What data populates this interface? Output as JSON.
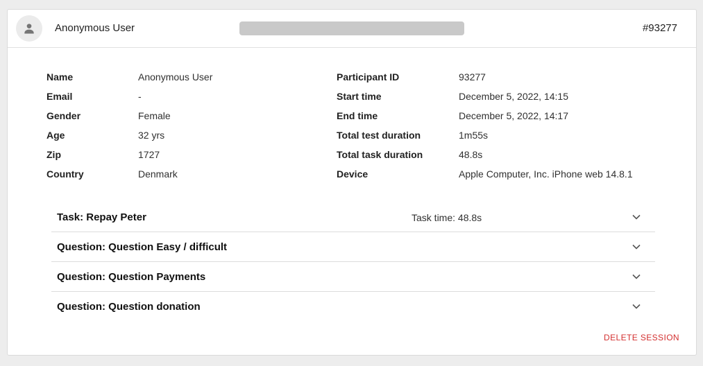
{
  "header": {
    "user_name": "Anonymous User",
    "participant_tag": "#93277"
  },
  "details_left": [
    {
      "label": "Name",
      "value": "Anonymous User"
    },
    {
      "label": "Email",
      "value": "-"
    },
    {
      "label": "Gender",
      "value": "Female"
    },
    {
      "label": "Age",
      "value": "32 yrs"
    },
    {
      "label": "Zip",
      "value": "1727"
    },
    {
      "label": "Country",
      "value": "Denmark"
    }
  ],
  "details_right": [
    {
      "label": "Participant ID",
      "value": "93277"
    },
    {
      "label": "Start time",
      "value": "December 5, 2022, 14:15"
    },
    {
      "label": "End time",
      "value": "December 5, 2022, 14:17"
    },
    {
      "label": "Total test duration",
      "value": "1m55s"
    },
    {
      "label": "Total task duration",
      "value": "48.8s"
    },
    {
      "label": "Device",
      "value": "Apple Computer, Inc. iPhone web 14.8.1"
    }
  ],
  "sections": [
    {
      "title": "Task: Repay Peter",
      "meta": "Task time: 48.8s"
    },
    {
      "title": "Question: Question Easy / difficult",
      "meta": ""
    },
    {
      "title": "Question: Question Payments",
      "meta": ""
    },
    {
      "title": "Question: Question donation",
      "meta": ""
    }
  ],
  "actions": {
    "delete_label": "DELETE SESSION"
  },
  "icons": {
    "avatar": "person-icon",
    "expand": "chevron-down-icon"
  },
  "colors": {
    "delete": "#d32f2f",
    "placeholder_bar": "#c9c9c9"
  }
}
